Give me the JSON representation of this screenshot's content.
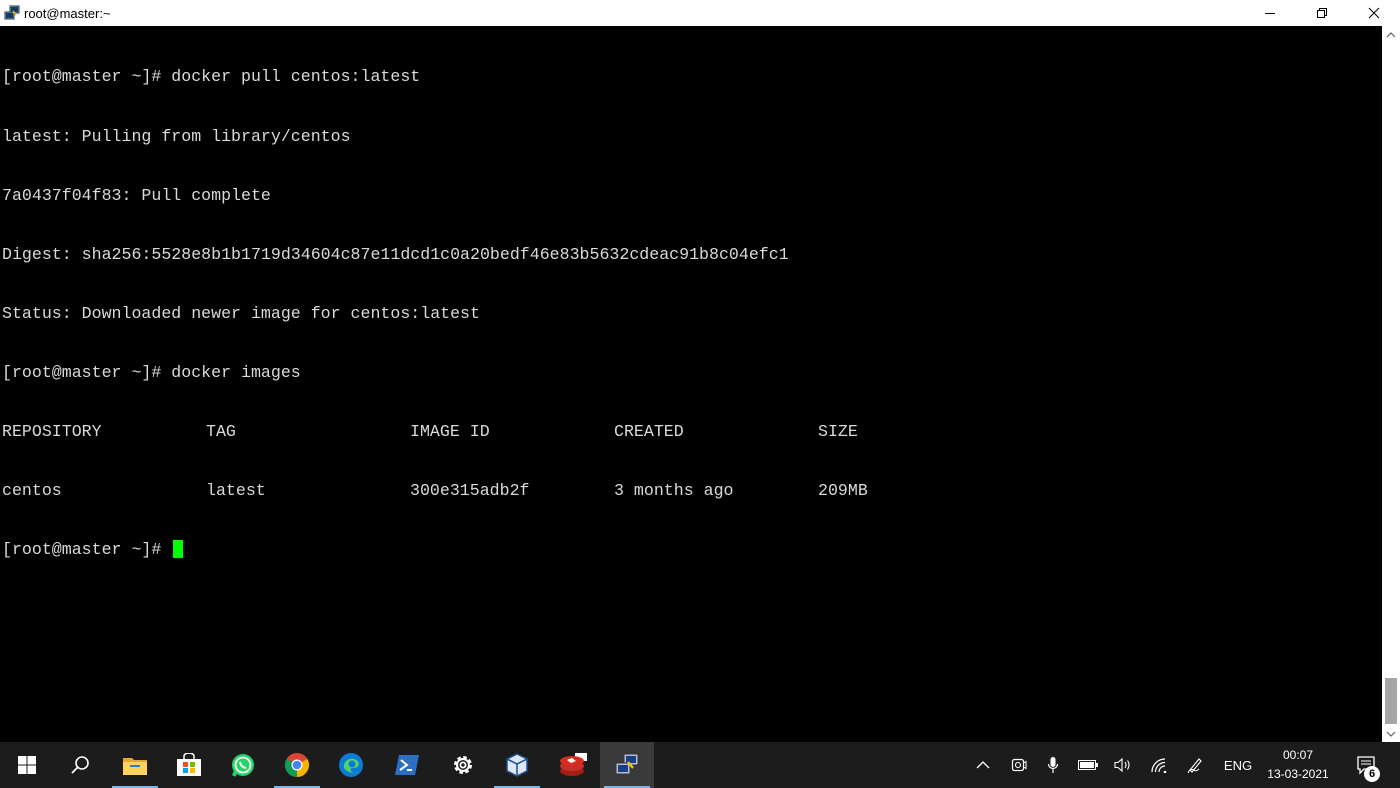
{
  "window": {
    "title": "root@master:~"
  },
  "terminal": {
    "lines": [
      "[root@master ~]# docker pull centos:latest",
      "latest: Pulling from library/centos",
      "7a0437f04f83: Pull complete",
      "Digest: sha256:5528e8b1b1719d34604c87e11dcd1c0a20bedf46e83b5632cdeac91b8c04efc1",
      "Status: Downloaded newer image for centos:latest",
      "[root@master ~]# docker images"
    ],
    "table": {
      "headers": [
        "REPOSITORY",
        "TAG",
        "IMAGE ID",
        "CREATED",
        "SIZE"
      ],
      "rows": [
        [
          "centos",
          "latest",
          "300e315adb2f",
          "3 months ago",
          "209MB"
        ]
      ]
    },
    "prompt": "[root@master ~]# ",
    "cursor_color": "#00ff00"
  },
  "taskbar": {
    "apps": [
      "start-icon",
      "search-icon",
      "file-explorer-icon",
      "store-icon",
      "whatsapp-icon",
      "chrome-icon",
      "edge-icon",
      "powershell-icon",
      "settings-icon",
      "virtualbox-icon",
      "redis-icon",
      "putty-icon"
    ],
    "active_app": "putty-icon",
    "language": "ENG",
    "time": "00:07",
    "date": "13-03-2021",
    "notification_count": "6"
  }
}
